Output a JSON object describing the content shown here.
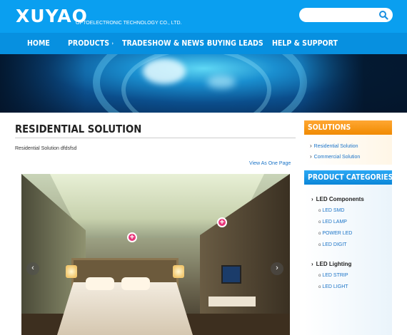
{
  "header": {
    "logo": "XUYAO",
    "logo_subtitle": "OPTOELECTRONIC TECHNOLOGY CO., LTD.",
    "search_placeholder": ""
  },
  "nav": {
    "items": [
      {
        "label": "HOME",
        "has_caret": false
      },
      {
        "label": "PRODUCTS",
        "has_caret": true
      },
      {
        "label": "TRADESHOW & NEWS",
        "has_caret": true
      },
      {
        "label": "BUYING LEADS",
        "has_caret": false
      },
      {
        "label": "HELP & SUPPORT",
        "has_caret": false
      }
    ],
    "caret": "›"
  },
  "main": {
    "title": "RESIDENTIAL SOLUTION",
    "description": "Residential Solution dfdsfsd",
    "view_link": "View As One Page",
    "gallery": {
      "prev": "‹",
      "next": "›",
      "hotspot": "+"
    }
  },
  "sidebar": {
    "solutions_title": "SOLUTIONS",
    "solutions": [
      "Residential Solution",
      "Commercial Solution"
    ],
    "categories_title": "PRODUCT CATEGORIES",
    "groups": [
      {
        "label": "LED Components",
        "items": [
          "LED SMD",
          "LED LAMP",
          "POWER LED",
          "LED DIGIT"
        ]
      },
      {
        "label": "LED Lighting",
        "items": [
          "LED STRIP",
          "LED LIGHT"
        ]
      }
    ]
  },
  "colors": {
    "header_blue": "#0a9ff0",
    "nav_blue": "#0790e0",
    "orange": "#f08a00",
    "link_blue": "#1a73c7",
    "hotspot_pink": "#e8367a"
  }
}
